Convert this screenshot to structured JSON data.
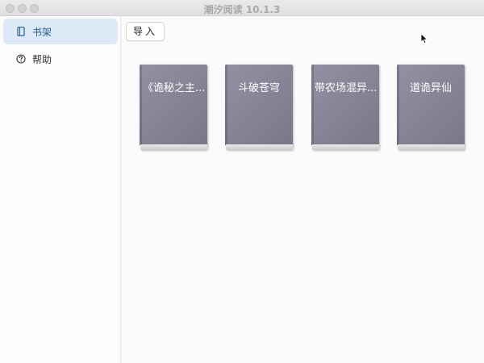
{
  "window": {
    "title": "潮汐阅读 10.1.3"
  },
  "sidebar": {
    "items": [
      {
        "label": "书架",
        "icon": "book-icon",
        "active": true
      },
      {
        "label": "帮助",
        "icon": "question-circle-icon",
        "active": false
      }
    ]
  },
  "toolbar": {
    "import_label": "导入"
  },
  "bookshelf": {
    "books": [
      {
        "title": "《诡秘之主..."
      },
      {
        "title": "斗破苍穹"
      },
      {
        "title": "带农场混异..."
      },
      {
        "title": "道诡异仙"
      }
    ]
  },
  "colors": {
    "accent": "#2b5d8a",
    "active_bg": "#dde9f7",
    "book_cover": "#8a8498"
  }
}
